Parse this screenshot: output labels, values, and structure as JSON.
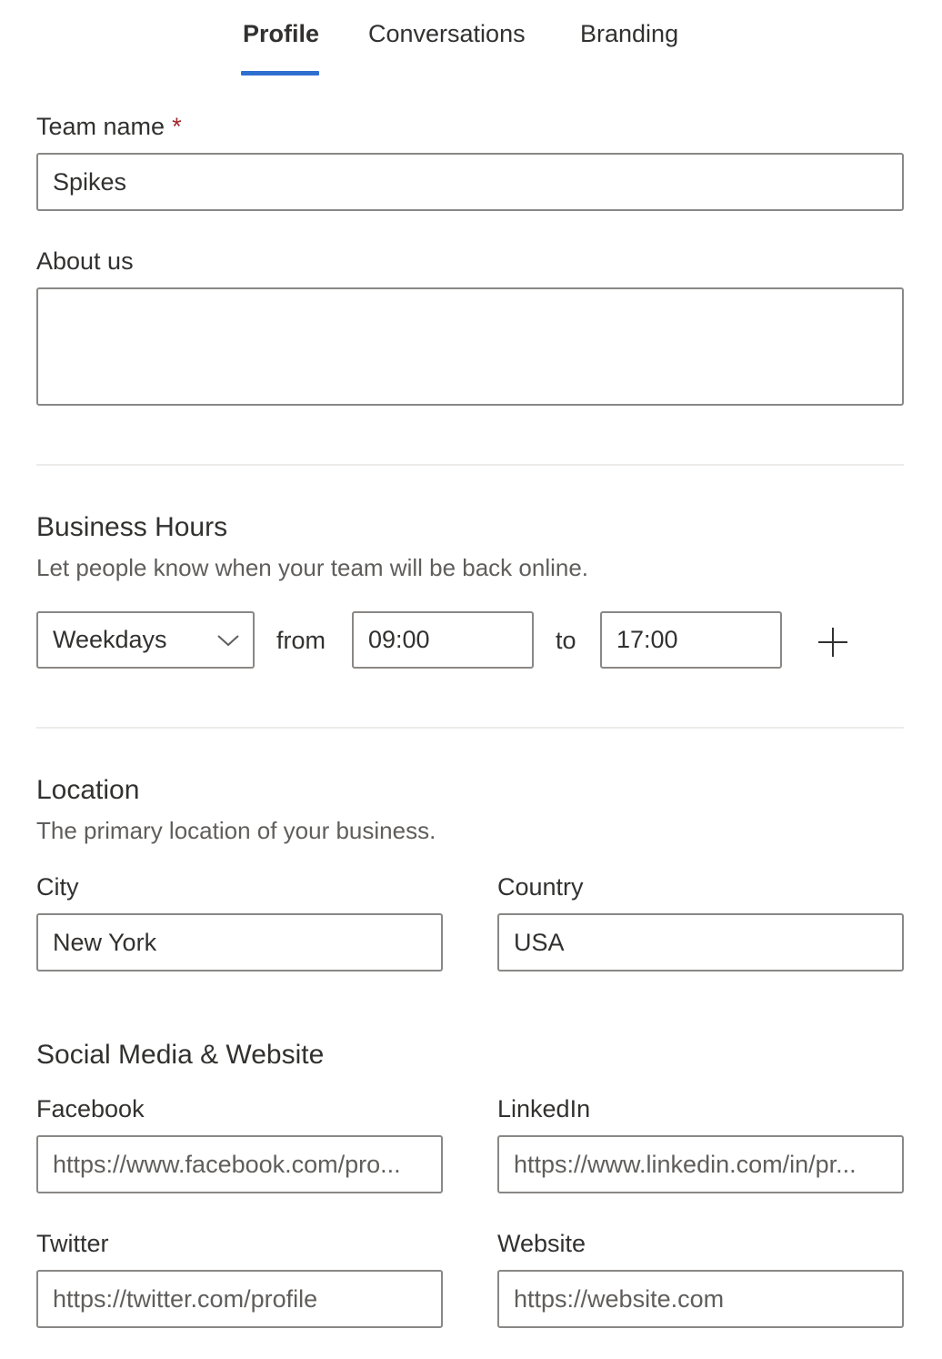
{
  "tabs": [
    {
      "label": "Profile",
      "active": true
    },
    {
      "label": "Conversations",
      "active": false
    },
    {
      "label": "Branding",
      "active": false
    }
  ],
  "accent_color": "#2f6fd0",
  "required_color": "#a4262c",
  "team_name": {
    "label": "Team name",
    "required_marker": "*",
    "value": "Spikes"
  },
  "about_us": {
    "label": "About us",
    "value": ""
  },
  "business_hours": {
    "title": "Business Hours",
    "description": "Let people know when your team will be back online.",
    "day_select": {
      "value": "Weekdays",
      "icon": "chevron-down-icon"
    },
    "from_label": "from",
    "from_value": "09:00",
    "to_label": "to",
    "to_value": "17:00",
    "add_icon": "plus-icon"
  },
  "location": {
    "title": "Location",
    "description": "The primary location of your business.",
    "city": {
      "label": "City",
      "value": "New York"
    },
    "country": {
      "label": "Country",
      "value": "USA"
    }
  },
  "social": {
    "title": "Social Media & Website",
    "facebook": {
      "label": "Facebook",
      "placeholder": "https://www.facebook.com/pro..."
    },
    "linkedin": {
      "label": "LinkedIn",
      "placeholder": "https://www.linkedin.com/in/pr..."
    },
    "twitter": {
      "label": "Twitter",
      "placeholder": "https://twitter.com/profile"
    },
    "website": {
      "label": "Website",
      "placeholder": "https://website.com"
    }
  }
}
